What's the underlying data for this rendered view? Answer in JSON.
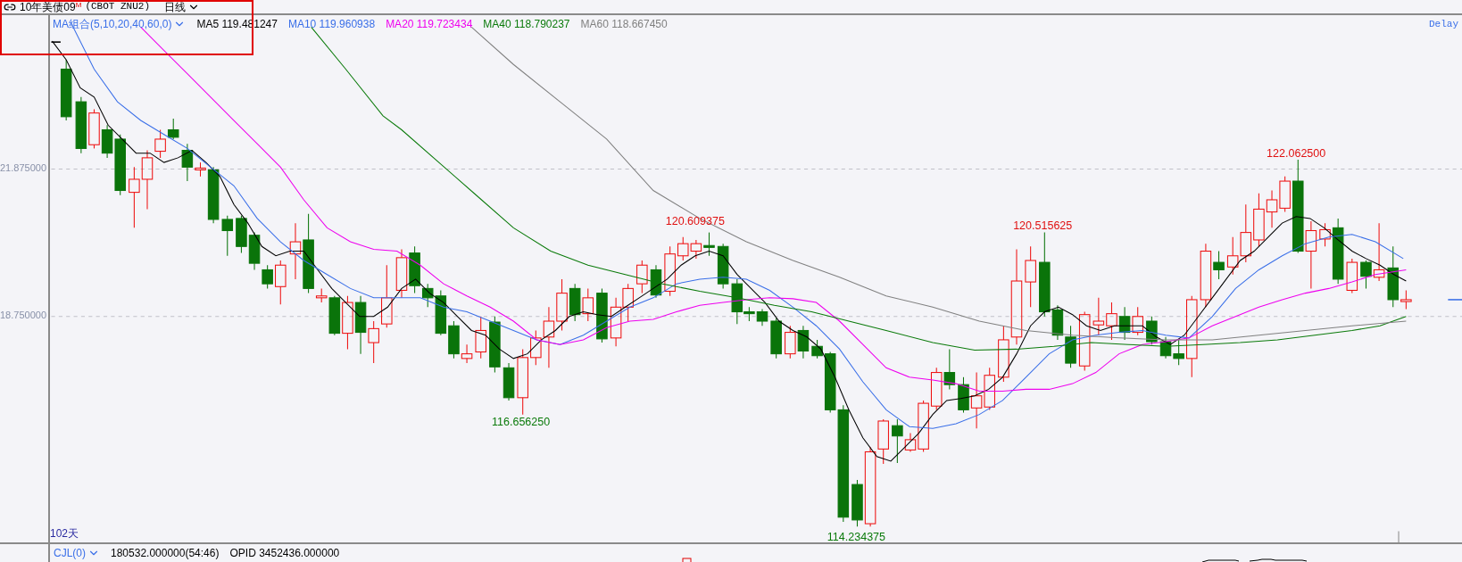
{
  "header": {
    "instrument": "10年美债09$^{M}$",
    "code": "(CBOT ZNU2)",
    "period": "日线"
  },
  "legend": {
    "indicator": "MA组合(5,10,20,40,60,0)",
    "averages": [
      {
        "label": "MA5 119.481247",
        "color": "#000000"
      },
      {
        "label": "MA10 119.960938",
        "color": "#3a6fe8"
      },
      {
        "label": "MA20 119.723434",
        "color": "#ee00ee"
      },
      {
        "label": "MA40 118.790237",
        "color": "#0a7a0a"
      },
      {
        "label": "MA60 118.667450",
        "color": "#808080"
      }
    ]
  },
  "status": "Delay",
  "axis": {
    "ticks": [
      "21.875000",
      "18.750000"
    ]
  },
  "annotations": [
    {
      "text": "120.609375",
      "kind": "high"
    },
    {
      "text": "120.515625",
      "kind": "high"
    },
    {
      "text": "122.062500",
      "kind": "high"
    },
    {
      "text": "116.656250",
      "kind": "low"
    },
    {
      "text": "114.234375",
      "kind": "low"
    }
  ],
  "span": "102天",
  "footer": {
    "indicator": "CJL(0)",
    "values": [
      "180532.000000(54:46)",
      "OPID 3452436.000000"
    ]
  }
}
